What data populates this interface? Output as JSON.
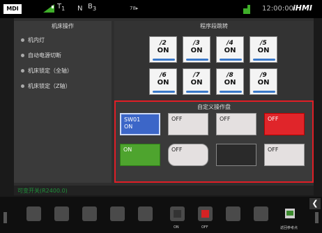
{
  "topbar": {
    "mode": "MDI",
    "tool_t": "T",
    "tool_num": "1",
    "status_n": "N",
    "status_b": "B",
    "status_b_num": "3",
    "program": "78▸",
    "time": "12:00:00",
    "brand": "iHMI"
  },
  "left_panel": {
    "title": "机床操作",
    "items": [
      {
        "label": "机内灯"
      },
      {
        "label": "自动电源切断"
      },
      {
        "label": "机床锁定（全轴）"
      },
      {
        "label": "机床锁定（Z轴）"
      }
    ]
  },
  "skip_panel": {
    "title": "程序段跳转",
    "buttons": [
      {
        "num": "/2",
        "state": "ON"
      },
      {
        "num": "/3",
        "state": "ON"
      },
      {
        "num": "/4",
        "state": "ON"
      },
      {
        "num": "/5",
        "state": "ON"
      },
      {
        "num": "/6",
        "state": "ON"
      },
      {
        "num": "/7",
        "state": "ON"
      },
      {
        "num": "/8",
        "state": "ON"
      },
      {
        "num": "/9",
        "state": "ON"
      }
    ]
  },
  "custom_panel": {
    "title": "自定义操作盘",
    "buttons": [
      {
        "line1": "SW01",
        "line2": "ON",
        "color": "#3c66c8"
      },
      {
        "line1": "OFF",
        "line2": "",
        "color": "#e4e0e0"
      },
      {
        "line1": "OFF",
        "line2": "",
        "color": "#e4e0e0"
      },
      {
        "line1": "OFF",
        "line2": "",
        "color": "#e0252a"
      },
      {
        "line1": "ON",
        "line2": "",
        "color": "#4ea42e"
      },
      {
        "line1": "OFF",
        "line2": "",
        "color": "#e4e0e0"
      },
      {
        "line1": "",
        "line2": "",
        "color": "#2a2a2a"
      },
      {
        "line1": "OFF",
        "line2": "",
        "color": "#e4e0e0"
      }
    ]
  },
  "status_line": "可变开关(R2400.0)",
  "softkeys": {
    "on_label": "ON",
    "off_label": "OFF",
    "ref_label": "返回参考点"
  },
  "colors": {
    "accent_red": "#e01e26",
    "skip_bar": "#3a78c8",
    "status_green": "#1f8f3a"
  }
}
